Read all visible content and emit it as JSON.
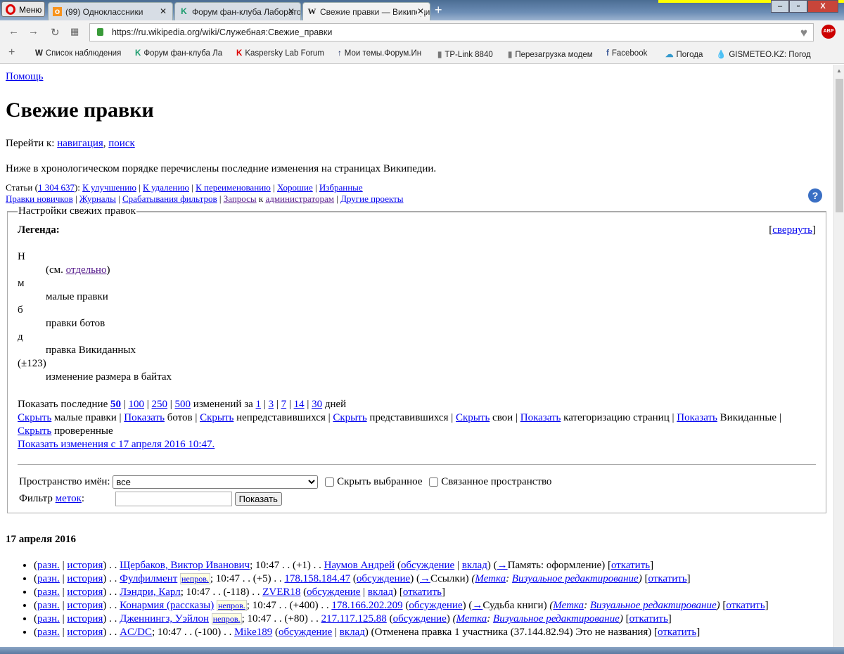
{
  "browser": {
    "menu_label": "Меню",
    "tabs": [
      {
        "title": "(99) Одноклассники",
        "icon": "ok-icon"
      },
      {
        "title": "Форум фан-клуба Лаборатории Касперского",
        "icon": "k-icon"
      },
      {
        "title": "Свежие правки — Википедия",
        "icon": "w-icon"
      }
    ],
    "url": "https://ru.wikipedia.org/wiki/Служебная:Свежие_правки",
    "abp": "ABP",
    "bookmarks": [
      "Список наблюдения",
      "Форум фан-клуба Ла",
      "Kaspersky Lab Forum",
      "Мои темы.Форум.Ин",
      "TP-Link 8840",
      "Перезагрузка модем",
      "Facebook",
      "Погода",
      "GISMETEO.KZ: Погод"
    ]
  },
  "page": {
    "help_link": "Помощь",
    "title": "Свежие правки",
    "jump_label": "Перейти к:",
    "jump_nav": "навигация",
    "jump_search": "поиск",
    "intro": "Ниже в хронологическом порядке перечислены последние изменения на страницах Википедии.",
    "articles_label": "Статьи",
    "articles_count": "1 304 637",
    "links_row1": [
      "К улучшению",
      "К удалению",
      "К переименованию",
      "Хорошие",
      "Избранные"
    ],
    "links_row2": [
      "Правки новичков",
      "Журналы",
      "Срабатывания фильтров"
    ],
    "requests": "Запросы",
    "to": "к",
    "admins": "администраторам",
    "other_projects": "Другие проекты"
  },
  "settings": {
    "legend_title": "Настройки свежих правок",
    "legend_label": "Легенда:",
    "collapse": "свернуть",
    "items": [
      {
        "term": "Н",
        "desc_pre": "(см. ",
        "desc_link": "отдельно",
        "desc_post": ")"
      },
      {
        "term": "м",
        "desc_pre": "малые правки",
        "desc_link": "",
        "desc_post": ""
      },
      {
        "term": "б",
        "desc_pre": "правки ботов",
        "desc_link": "",
        "desc_post": ""
      },
      {
        "term": "д",
        "desc_pre": "правка Викиданных",
        "desc_link": "",
        "desc_post": ""
      },
      {
        "term": "(±123)",
        "desc_pre": "изменение размера в байтах",
        "desc_link": "",
        "desc_post": ""
      }
    ],
    "show_last": "Показать последние",
    "limits": [
      "50",
      "100",
      "250",
      "500"
    ],
    "changes_for": "изменений за",
    "days": [
      "1",
      "3",
      "7",
      "14",
      "30"
    ],
    "days_label": "дней",
    "toggles": [
      {
        "action": "Скрыть",
        "label": "малые правки"
      },
      {
        "action": "Показать",
        "label": "ботов"
      },
      {
        "action": "Скрыть",
        "label": "непредставившихся"
      },
      {
        "action": "Скрыть",
        "label": "представившихся"
      },
      {
        "action": "Скрыть",
        "label": "свои"
      },
      {
        "action": "Показать",
        "label": "категоризацию страниц"
      },
      {
        "action": "Показать",
        "label": "Викиданные"
      },
      {
        "action": "Скрыть",
        "label": "проверенные"
      }
    ],
    "show_since": "Показать изменения с 17 апреля 2016 10:47.",
    "namespace_label": "Пространство имён:",
    "namespace_value": "все",
    "hide_selected": "Скрыть выбранное",
    "associated": "Связанное пространство",
    "filter_label": "Фильтр",
    "filter_link": "меток",
    "filter_value": "",
    "show_button": "Показать"
  },
  "changes": {
    "date": "17 апреля 2016",
    "rows": [
      {
        "title": "Щербаков, Виктор Иванович",
        "np": "",
        "size": "(+1)",
        "user": "Наумов Андрей",
        "contrib": true,
        "comment_link": "→",
        "comment": "Память: оформление",
        "tag": ""
      },
      {
        "title": "Фулфилмент",
        "np": "непров.",
        "size": "(+5)",
        "user": "178.158.184.47",
        "contrib": false,
        "comment_link": "→",
        "comment": "Ссылки",
        "tag": "Визуальное редактирование"
      },
      {
        "title": "Лэндри, Карл",
        "np": "",
        "size": "(-118)",
        "user": "ZVER18",
        "contrib": true,
        "comment_link": "",
        "comment": "",
        "tag": ""
      },
      {
        "title": "Конармия (рассказы)",
        "np": "непров.",
        "size": "(+400)",
        "user": "178.166.202.209",
        "contrib": false,
        "comment_link": "→",
        "comment": "Судьба книги",
        "tag": "Визуальное редактирование"
      },
      {
        "title": "Дженнингз, Уэйлон",
        "np": "непров.",
        "size": "(+80)",
        "user": "217.117.125.88",
        "contrib": false,
        "comment_link": "",
        "comment": "",
        "tag": "Визуальное редактирование"
      },
      {
        "title": "AC/DC",
        "np": "",
        "size": "(-100)",
        "user": "Mike189",
        "contrib": true,
        "comment_link": "",
        "comment": "Отменена правка 1 участника (37.144.82.94) Это не названия",
        "tag": ""
      }
    ],
    "diff": "разн.",
    "hist": "история",
    "time": "10:47",
    "talk": "обсуждение",
    "contribs": "вклад",
    "tag_label": "Метка",
    "rollback": "откатить"
  }
}
